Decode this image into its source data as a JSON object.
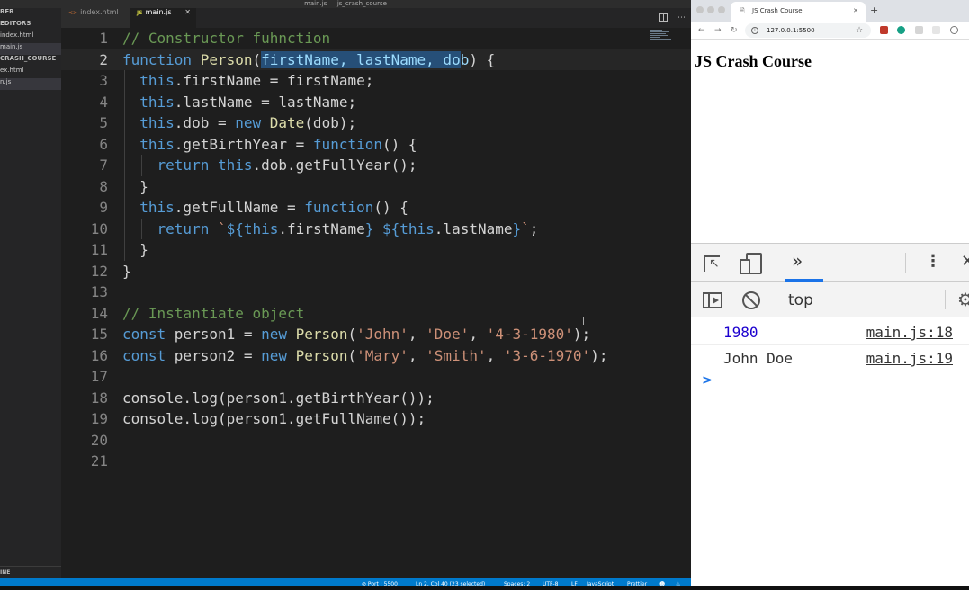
{
  "window": {
    "title": "main.js — js_crash_course"
  },
  "sidebar": {
    "rows": [
      {
        "label": "RER",
        "style": "head"
      },
      {
        "label": "EDITORS",
        "style": "head"
      },
      {
        "label": "index.html",
        "style": "normal"
      },
      {
        "label": "main.js",
        "style": "active"
      },
      {
        "label": "CRASH_COURSE",
        "style": "head"
      },
      {
        "label": "ex.html",
        "style": "normal"
      },
      {
        "label": "n.js",
        "style": "active"
      }
    ],
    "outline_label": "INE"
  },
  "editor": {
    "tabs": [
      {
        "label": "index.html",
        "icon": "<>"
      },
      {
        "label": "main.js",
        "icon": "JS"
      }
    ],
    "lines": [
      {
        "n": "1",
        "segs": [
          [
            "// Constructor fuhnction",
            "comment"
          ]
        ]
      },
      {
        "n": "2",
        "segs": [
          [
            "function ",
            "kw"
          ],
          [
            "Person",
            "fn"
          ],
          [
            "(",
            "plain"
          ],
          [
            "firstName, lastName, do",
            "var sel"
          ],
          [
            "b",
            "var"
          ],
          [
            ") {",
            "plain"
          ]
        ]
      },
      {
        "n": "3",
        "segs": [
          [
            "  ",
            "plain"
          ],
          [
            "this",
            "kw"
          ],
          [
            ".firstName = firstName;",
            "plain"
          ]
        ]
      },
      {
        "n": "4",
        "segs": [
          [
            "  ",
            "plain"
          ],
          [
            "this",
            "kw"
          ],
          [
            ".lastName = lastName;",
            "plain"
          ]
        ]
      },
      {
        "n": "5",
        "segs": [
          [
            "  ",
            "plain"
          ],
          [
            "this",
            "kw"
          ],
          [
            ".dob = ",
            "plain"
          ],
          [
            "new ",
            "kw"
          ],
          [
            "Date",
            "fn"
          ],
          [
            "(dob);",
            "plain"
          ]
        ]
      },
      {
        "n": "6",
        "segs": [
          [
            "  ",
            "plain"
          ],
          [
            "this",
            "kw"
          ],
          [
            ".getBirthYear = ",
            "plain"
          ],
          [
            "function",
            "kw"
          ],
          [
            "() {",
            "plain"
          ]
        ]
      },
      {
        "n": "7",
        "segs": [
          [
            "    ",
            "plain"
          ],
          [
            "return ",
            "kw"
          ],
          [
            "this",
            "kw"
          ],
          [
            ".dob.getFullYear();",
            "plain"
          ]
        ]
      },
      {
        "n": "8",
        "segs": [
          [
            "  }",
            "plain"
          ]
        ]
      },
      {
        "n": "9",
        "segs": [
          [
            "  ",
            "plain"
          ],
          [
            "this",
            "kw"
          ],
          [
            ".getFullName = ",
            "plain"
          ],
          [
            "function",
            "kw"
          ],
          [
            "() {",
            "plain"
          ]
        ]
      },
      {
        "n": "10",
        "segs": [
          [
            "    ",
            "plain"
          ],
          [
            "return ",
            "kw"
          ],
          [
            "`",
            "str"
          ],
          [
            "${",
            "kw"
          ],
          [
            "this",
            "kw"
          ],
          [
            ".firstName",
            "plain"
          ],
          [
            "} ",
            "kw"
          ],
          [
            "${",
            "kw"
          ],
          [
            "this",
            "kw"
          ],
          [
            ".lastName",
            "plain"
          ],
          [
            "}",
            "kw"
          ],
          [
            "`",
            "str"
          ],
          [
            ";",
            "plain"
          ]
        ]
      },
      {
        "n": "11",
        "segs": [
          [
            "  }",
            "plain"
          ]
        ]
      },
      {
        "n": "12",
        "segs": [
          [
            "}",
            "plain"
          ]
        ]
      },
      {
        "n": "13",
        "segs": []
      },
      {
        "n": "14",
        "segs": [
          [
            "// Instantiate object",
            "comment"
          ]
        ]
      },
      {
        "n": "15",
        "segs": [
          [
            "const ",
            "kw"
          ],
          [
            "person1 = ",
            "plain"
          ],
          [
            "new ",
            "kw"
          ],
          [
            "Person",
            "fn"
          ],
          [
            "(",
            "plain"
          ],
          [
            "'John'",
            "str"
          ],
          [
            ", ",
            "plain"
          ],
          [
            "'Doe'",
            "str"
          ],
          [
            ", ",
            "plain"
          ],
          [
            "'4-3-1980'",
            "str"
          ],
          [
            ");",
            "plain"
          ]
        ]
      },
      {
        "n": "16",
        "segs": [
          [
            "const ",
            "kw"
          ],
          [
            "person2 = ",
            "plain"
          ],
          [
            "new ",
            "kw"
          ],
          [
            "Person",
            "fn"
          ],
          [
            "(",
            "plain"
          ],
          [
            "'Mary'",
            "str"
          ],
          [
            ", ",
            "plain"
          ],
          [
            "'Smith'",
            "str"
          ],
          [
            ", ",
            "plain"
          ],
          [
            "'3-6-1970'",
            "str"
          ],
          [
            ");",
            "plain"
          ]
        ]
      },
      {
        "n": "17",
        "segs": []
      },
      {
        "n": "18",
        "segs": [
          [
            "console.log(person1.getBirthYear());",
            "plain"
          ]
        ]
      },
      {
        "n": "19",
        "segs": [
          [
            "console.log(person1.getFullName());",
            "plain"
          ]
        ]
      },
      {
        "n": "20",
        "segs": []
      },
      {
        "n": "21",
        "segs": []
      }
    ],
    "current_line": "2"
  },
  "status_bar": {
    "port": "⊘ Port : 5500",
    "position": "Ln 2, Col 40 (23 selected)",
    "spaces": "Spaces: 2",
    "encoding": "UTF-8",
    "eol": "LF",
    "language": "JavaScript",
    "formatter": "Prettier"
  },
  "browser": {
    "tab_title": "JS Crash Course",
    "url": "127.0.0.1:5500",
    "page_heading": "JS Crash Course"
  },
  "devtools": {
    "context": "top",
    "console_rows": [
      {
        "message": "1980",
        "source": "main.js:18",
        "kind": "num"
      },
      {
        "message": "John Doe",
        "source": "main.js:19",
        "kind": "text"
      }
    ],
    "prompt": ">"
  },
  "colors": {
    "editor_bg": "#1e1e1e",
    "status_bar": "#007acc",
    "keyword": "#569cd6",
    "string": "#ce9178",
    "comment": "#6a9955",
    "selection": "#264f78"
  }
}
